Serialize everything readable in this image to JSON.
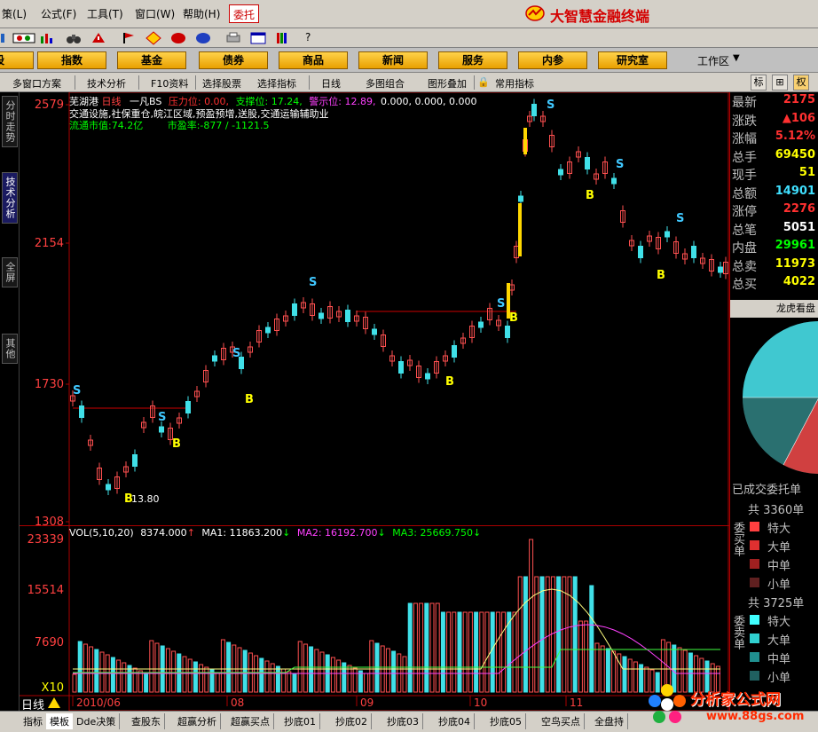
{
  "menu": {
    "items": [
      "策(L)",
      "公式(F)",
      "工具(T)",
      "窗口(W)",
      "帮助(H)"
    ],
    "weituo": "委托",
    "brand": "大智慧金融终端"
  },
  "toolbar": {
    "help": "?"
  },
  "categories": [
    "股",
    "指数",
    "基金",
    "债券",
    "商品",
    "新闻",
    "服务",
    "内参",
    "研究室"
  ],
  "workspace": "工作区",
  "funcbar": {
    "items": [
      "多窗口方案",
      "技术分析",
      "F10资料",
      "选择股票",
      "选择指标",
      "日线",
      "多图组合",
      "图形叠加",
      "常用指标"
    ],
    "right_buttons": [
      "标",
      "⊞",
      "权"
    ]
  },
  "left_tabs": [
    "分时走势",
    "技术分析",
    "全屏",
    "其他"
  ],
  "stock": {
    "name": "芜湖港",
    "period": "日线",
    "indicator": "一凡BS",
    "pressure_label": "压力位:",
    "pressure_value": "0.00,",
    "support_label": "支撑位:",
    "support_value": "17.24,",
    "warn_label": "警示位:",
    "warn_value": "12.89,",
    "zeros": "0.000, 0.000, 0.000",
    "tags": "交通设施,社保重仓,皖江区域,预盈预增,送股,交通运输辅助业",
    "market_cap": "流通市值:74.2亿",
    "pe": "市盈率:-877 / -1121.5"
  },
  "price_axis": [
    "2579",
    "2154",
    "1730",
    "1308"
  ],
  "vol_axis": [
    "23339",
    "15514",
    "7690",
    "X10"
  ],
  "vol_line": {
    "label": "VOL(5,10,20)",
    "vol": "8374.000",
    "ma1": "MA1: 11863.200",
    "ma2": "MA2: 16192.700",
    "ma3": "MA3: 25669.750"
  },
  "date_axis": [
    "2010/06",
    "08",
    "09",
    "10",
    "11"
  ],
  "chart_data": {
    "type": "candlestick",
    "price_range": [
      1308,
      2579
    ],
    "volume_range": [
      0,
      23339
    ],
    "low_annotation": "13.80",
    "markers": [
      "S",
      "B"
    ]
  },
  "quote": {
    "rows": [
      {
        "label": "最新",
        "value": "2175",
        "color": "#ff3030"
      },
      {
        "label": "涨跌",
        "value": "▲106",
        "color": "#ff3030"
      },
      {
        "label": "涨幅",
        "value": "5.12%",
        "color": "#ff3030"
      },
      {
        "label": "总手",
        "value": "69450",
        "color": "#ffff00"
      },
      {
        "label": "现手",
        "value": "51",
        "color": "#ffff00"
      },
      {
        "label": "总额",
        "value": "14901",
        "color": "#40e0ff"
      },
      {
        "label": "涨停",
        "value": "2276",
        "color": "#ff3030"
      },
      {
        "label": "总笔",
        "value": "5051",
        "color": "#ffffff"
      },
      {
        "label": "内盘",
        "value": "29961",
        "color": "#00ff00"
      },
      {
        "label": "总卖",
        "value": "11973",
        "color": "#ffff00"
      },
      {
        "label": "总买",
        "value": "4022",
        "color": "#ffff00"
      }
    ]
  },
  "longhu": "龙虎看盘",
  "deals": {
    "title": "已成交委托单",
    "buy_label": "委买单",
    "buy_total": "共 3360单",
    "sell_label": "委卖单",
    "sell_total": "共 3725单",
    "buy_rows": [
      {
        "label": "特大",
        "color": "#ff4040"
      },
      {
        "label": "大单",
        "color": "#e03030"
      },
      {
        "label": "中单",
        "color": "#a02020"
      },
      {
        "label": "小单",
        "color": "#602020"
      }
    ],
    "sell_rows": [
      {
        "label": "特大",
        "color": "#40ffff"
      },
      {
        "label": "大单",
        "color": "#30d0d0"
      },
      {
        "label": "中单",
        "color": "#209090"
      },
      {
        "label": "小单",
        "color": "#206060"
      }
    ]
  },
  "period_label": "日线",
  "bottom_tabs": [
    "指标",
    "模板",
    "Dde决策",
    "查股东",
    "超赢分析",
    "超赢买点",
    "抄底01",
    "抄底02",
    "抄底03",
    "抄底04",
    "抄底05",
    "空鸟买点",
    "全盘持"
  ],
  "watermark": {
    "title": "分析家公式网",
    "url": "www.88gs.com"
  }
}
